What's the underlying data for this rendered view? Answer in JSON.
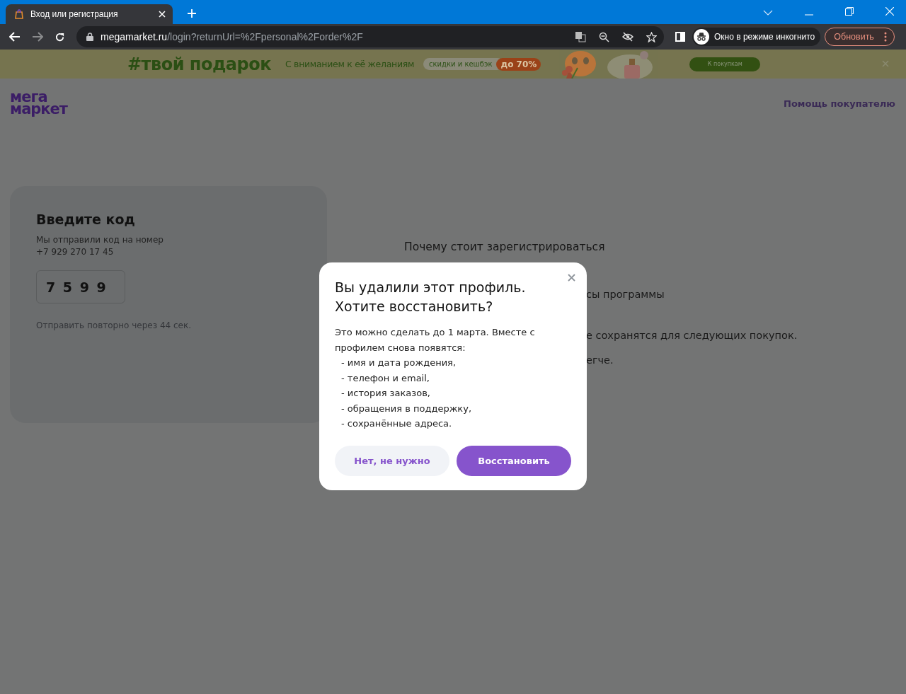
{
  "browser": {
    "tab": {
      "title": "Вход или регистрация",
      "selected": true
    },
    "url_host": "megamarket.ru",
    "url_path": "/login?returnUrl=%2Fpersonal%2Forder%2F",
    "incognito_label": "Окно в режиме инкогнито",
    "update_button": "Обновить"
  },
  "banner": {
    "headline": "#твой подарок",
    "tagline": "С вниманием к её желаниям",
    "pill": "скидки и кешбэк",
    "discount": "до 70%",
    "button": "К покупкам"
  },
  "header": {
    "logo_top": "мега",
    "logo_bottom": "маркет",
    "help_link": "Помощь покупателю"
  },
  "code_card": {
    "title": "Введите код",
    "subtitle": "Мы отправили код на номер",
    "phone": "+7 929 270 17 45",
    "code": "7 5 9 9",
    "resend": "Отправить повторно через 44 сек."
  },
  "benefits": {
    "title": "Почему стоит зарегистрироваться",
    "fragments": [
      "сы программы",
      "е сохранятся для следующих покупок.",
      "егче."
    ]
  },
  "dialog": {
    "title": "Вы удалили этот профиль. Хотите восстановить?",
    "intro": "Это можно сделать до 1 марта. Вместе с профилем снова появятся:",
    "items": [
      "- имя и дата рождения,",
      "- телефон и email,",
      "- история заказов,",
      "- обращения в поддержку,",
      "- сохранённые адреса."
    ],
    "buttons": [
      {
        "label": "Нет, не нужно",
        "kind": "secondary"
      },
      {
        "label": "Восстановить",
        "kind": "primary"
      }
    ]
  }
}
